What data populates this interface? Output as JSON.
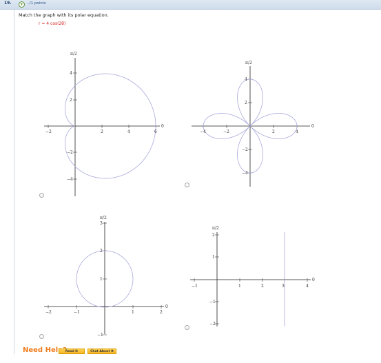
{
  "header": {
    "question_number": "19.",
    "points": "–/1 points",
    "plus_symbol": "+"
  },
  "prompt": "Match the graph with its polar equation.",
  "equation": "r = 4 cos(2θ)",
  "graphs": [
    {
      "id": "A",
      "pi_label": "π/2",
      "x_ticks": [
        "−2",
        "2",
        "4",
        "6"
      ],
      "y_ticks": [
        "4",
        "2",
        "−2",
        "−4"
      ],
      "axis_zero": "0",
      "curve": "cardioid r = 3 + 3 cos θ",
      "selected": false
    },
    {
      "id": "B",
      "pi_label": "π/2",
      "x_ticks": [
        "−4",
        "−2",
        "2",
        "4"
      ],
      "y_ticks": [
        "4",
        "2",
        "−2",
        "−4"
      ],
      "axis_zero": "0",
      "curve": "four-petal rose",
      "selected": false
    },
    {
      "id": "C",
      "pi_label": "π/2",
      "x_ticks": [
        "−2",
        "−1",
        "1",
        "2"
      ],
      "y_ticks": [
        "3",
        "2",
        "1",
        "−1"
      ],
      "axis_zero": "0",
      "curve": "circle r = 2 sin θ",
      "selected": false
    },
    {
      "id": "D",
      "pi_label": "π/2",
      "x_ticks": [
        "−1",
        "1",
        "2",
        "3",
        "4"
      ],
      "y_ticks": [
        "2",
        "1",
        "−1",
        "−2"
      ],
      "axis_zero": "0",
      "curve": "vertical line x = 3",
      "selected": false
    }
  ],
  "colors": {
    "curve": "#a8a8dc",
    "axis": "#222222",
    "equation": "#d42020",
    "need_help": "#f07c1c",
    "button": "#f6b42a"
  },
  "need_help": {
    "label": "Need Help?",
    "read_it": "Read It",
    "chat_about_it": "Chat About It"
  }
}
